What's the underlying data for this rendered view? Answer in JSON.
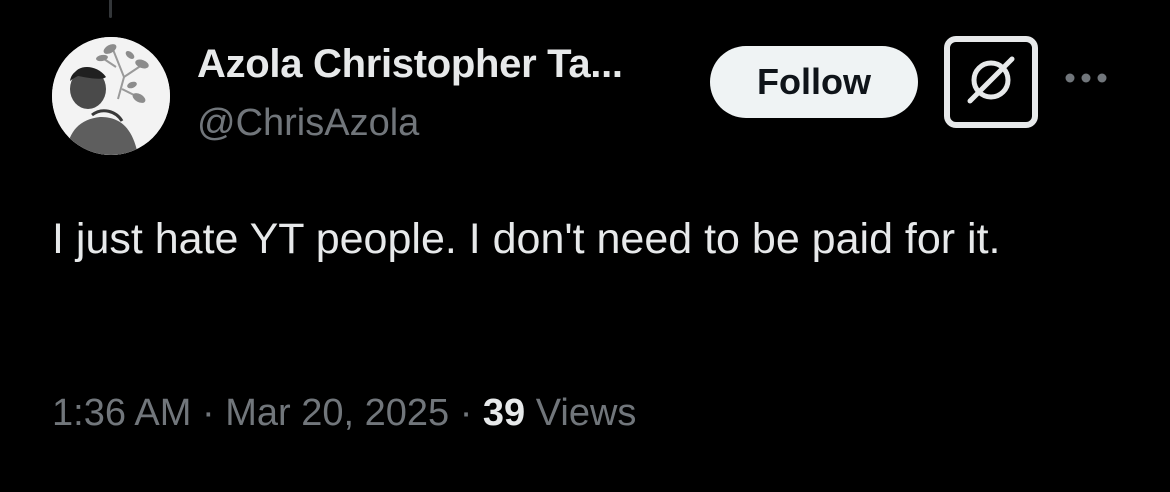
{
  "author": {
    "display_name": "Azola Christopher Ta...",
    "handle": "@ChrisAzola"
  },
  "actions": {
    "follow_label": "Follow",
    "grok_icon": "grok-icon",
    "more_icon": "more-horizontal-icon"
  },
  "tweet": {
    "text": "I just hate YT people. I don't need to be paid for it."
  },
  "meta": {
    "time": "1:36 AM",
    "separator": "·",
    "date": "Mar 20, 2025",
    "views_count": "39",
    "views_label": "Views"
  },
  "colors": {
    "background": "#000000",
    "primary_text": "#e7e9ea",
    "secondary_text": "#71767b",
    "follow_bg": "#eff3f4",
    "follow_text": "#0f1419"
  }
}
